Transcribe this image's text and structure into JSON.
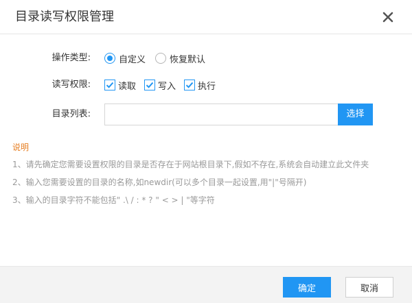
{
  "dialog": {
    "title": "目录读写权限管理",
    "close_icon": "close-icon"
  },
  "form": {
    "op_type": {
      "label": "操作类型:",
      "options": [
        {
          "label": "自定义",
          "checked": true
        },
        {
          "label": "恢复默认",
          "checked": false
        }
      ]
    },
    "permissions": {
      "label": "读写权限:",
      "options": [
        {
          "label": "读取",
          "checked": true
        },
        {
          "label": "写入",
          "checked": true
        },
        {
          "label": "执行",
          "checked": true
        }
      ]
    },
    "dir_list": {
      "label": "目录列表:",
      "value": "",
      "placeholder": "",
      "select_label": "选择"
    }
  },
  "notes": {
    "title": "说明",
    "lines": [
      "1、请先确定您需要设置权限的目录是否存在于网站根目录下,假如不存在,系统会自动建立此文件夹",
      "2、输入您需要设置的目录的名称,如newdir(可以多个目录一起设置,用\"|\"号隔开)",
      "3、输入的目录字符不能包括\" .\\ / : * ? \" < > | \"等字符"
    ]
  },
  "footer": {
    "ok_label": "确定",
    "cancel_label": "取消"
  },
  "colors": {
    "accent": "#2196f3",
    "note_title": "#e67e22",
    "note_text": "#999999",
    "footer_bg": "#f3f3f3"
  }
}
